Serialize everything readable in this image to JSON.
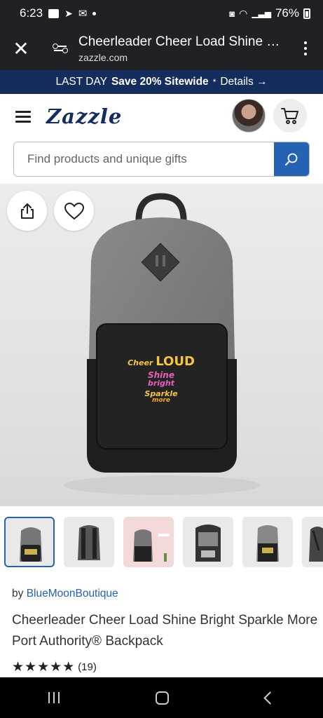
{
  "status": {
    "time": "6:23",
    "battery": "76%"
  },
  "browser": {
    "page_title": "Cheerleader Cheer Load Shine Br...",
    "domain": "zazzle.com"
  },
  "promo": {
    "prefix": "LAST DAY",
    "offer": "Save 20% Sitewide",
    "asterisk": "*",
    "details": "Details →"
  },
  "site": {
    "logo": "Zazzle"
  },
  "search": {
    "placeholder": "Find products and unique gifts"
  },
  "design_text": {
    "line1a": "Cheer",
    "line1b": "LOUD",
    "line2": "Shine",
    "line3": "bright",
    "line4": "Sparkle",
    "line5": "more"
  },
  "product": {
    "by_prefix": "by",
    "seller": "BlueMoonBoutique",
    "title": "Cheerleader Cheer Load Shine Bright Sparkle More Port Authority® Backpack",
    "stars": "★★★★★",
    "review_count": "(19)",
    "rating": 5
  },
  "colors": {
    "brand_navy": "#152d5d",
    "accent_blue": "#2463b3"
  }
}
